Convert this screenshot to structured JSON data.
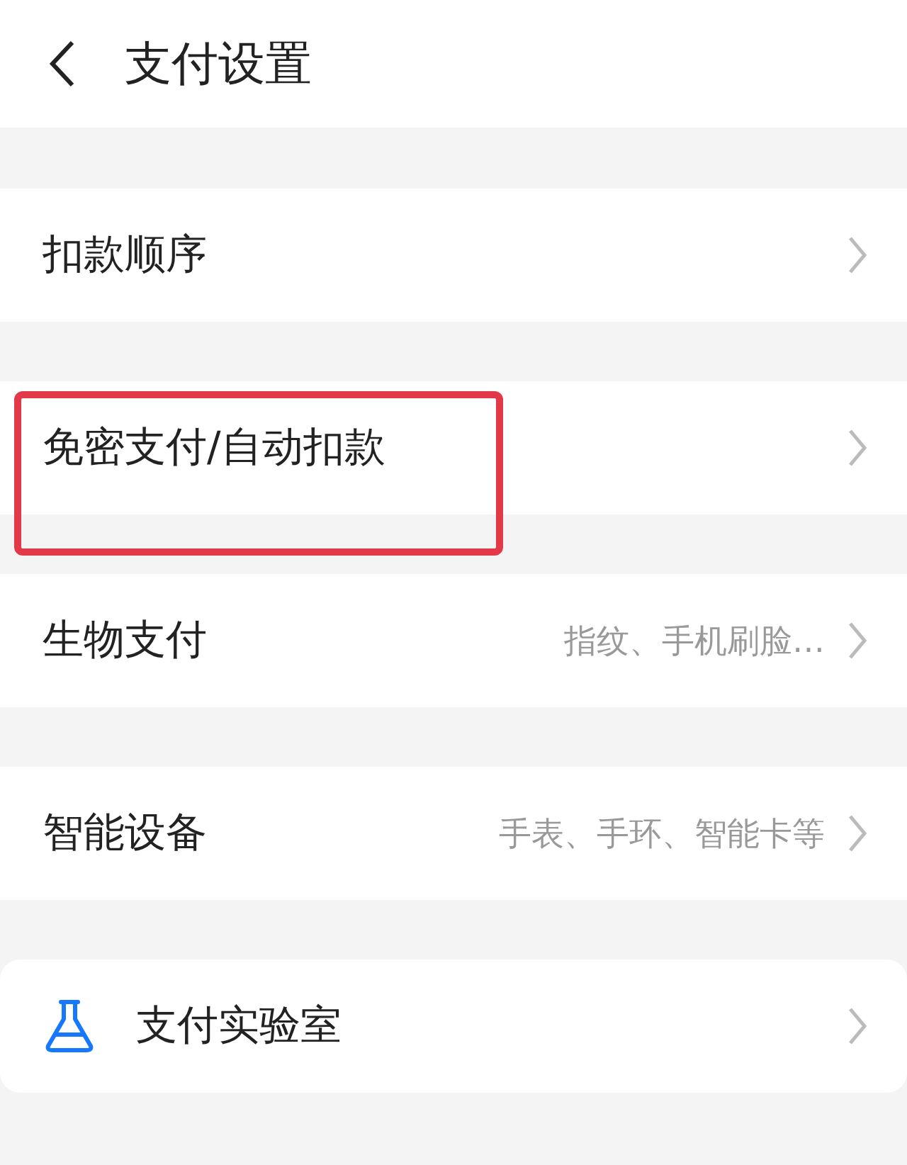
{
  "header": {
    "title": "支付设置"
  },
  "items": [
    {
      "kind": "plain",
      "label": "扣款顺序",
      "highlighted": false
    },
    {
      "kind": "plain",
      "label": "免密支付/自动扣款",
      "highlighted": true
    },
    {
      "kind": "plain",
      "label": "生物支付",
      "hint": "指纹、手机刷脸…",
      "highlighted": false
    },
    {
      "kind": "plain",
      "label": "智能设备",
      "hint": "手表、手环、智能卡等",
      "highlighted": false
    },
    {
      "kind": "lab",
      "label": "支付实验室",
      "highlighted": false
    }
  ]
}
